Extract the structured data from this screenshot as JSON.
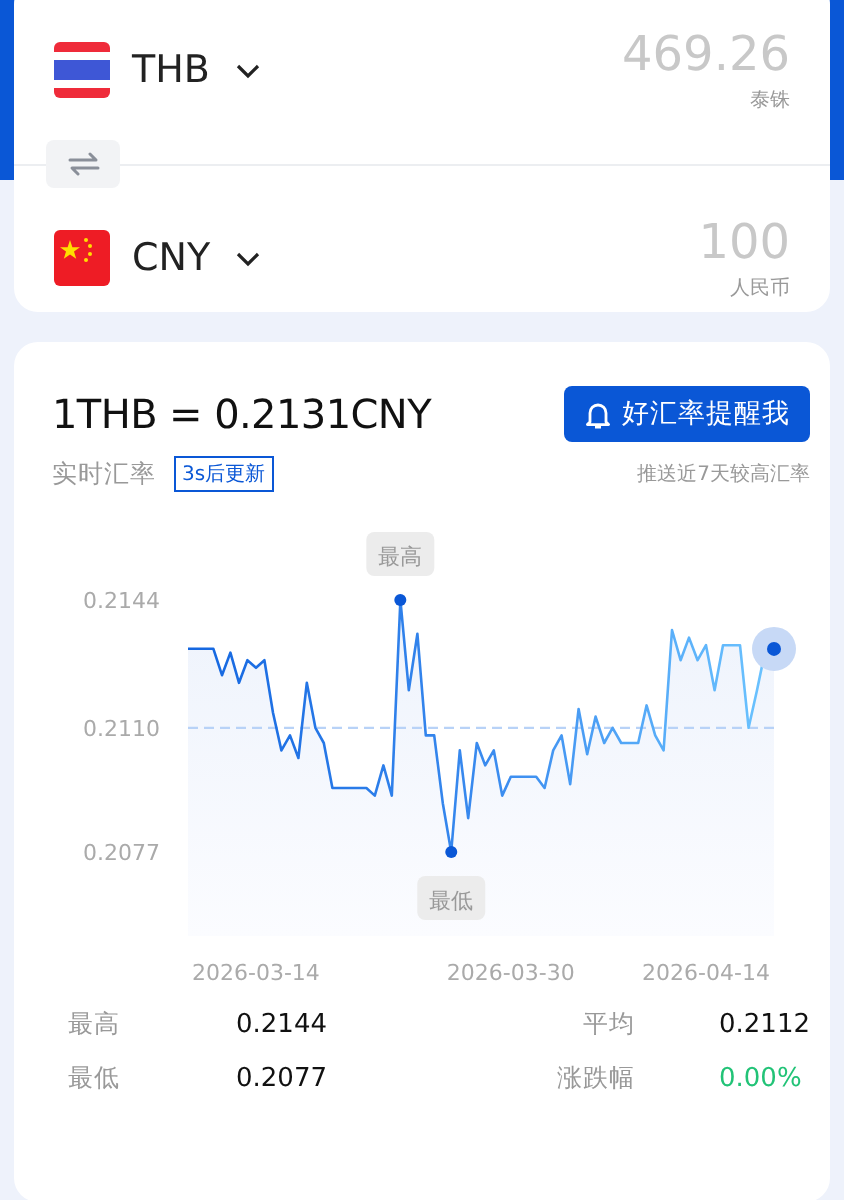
{
  "converter": {
    "currencies": [
      {
        "kind": "th",
        "code": "THB",
        "amount": "469.26",
        "name": "泰铢"
      },
      {
        "kind": "cn",
        "code": "CNY",
        "amount": "100",
        "name": "人民币"
      }
    ]
  },
  "rate": {
    "title": "1THB = 0.2131CNY",
    "label": "实时汇率",
    "refresh": "3s后更新",
    "alert_button": "好汇率提醒我",
    "alert_note": "推送近7天较高汇率"
  },
  "chart_data": {
    "type": "area",
    "ylim": [
      0.2077,
      0.2144
    ],
    "yticks": [
      {
        "value": 0.2144,
        "label": "0.2144"
      },
      {
        "value": 0.211,
        "label": "0.2110"
      },
      {
        "value": 0.2077,
        "label": "0.2077"
      }
    ],
    "categories": [
      null,
      null,
      null,
      null,
      null,
      null,
      null,
      null,
      "2026-03-14",
      null,
      null,
      null,
      null,
      null,
      null,
      null,
      null,
      null,
      null,
      null,
      null,
      null,
      null,
      null,
      null,
      null,
      null,
      null,
      null,
      null,
      null,
      null,
      null,
      null,
      null,
      null,
      null,
      null,
      "2026-03-30",
      null,
      null,
      null,
      null,
      null,
      null,
      null,
      null,
      null,
      null,
      null,
      null,
      null,
      null,
      null,
      null,
      null,
      null,
      null,
      null,
      null,
      null,
      "2026-04-14",
      null,
      null,
      null,
      null,
      null,
      null,
      null,
      null
    ],
    "series": [
      {
        "color": "#1466e0",
        "values": [
          0.2131,
          0.2131,
          0.2131,
          0.2131,
          0.2124,
          0.213,
          0.2122,
          0.2128,
          0.2126,
          0.2128,
          0.2114,
          0.2104,
          0.2108,
          0.2102,
          0.2122,
          0.211,
          0.2106,
          0.2094,
          0.2094,
          0.2094,
          0.2094,
          0.2094,
          0.2092,
          0.21,
          0.2092,
          0.2144,
          0.212,
          0.2135,
          0.2108,
          0.2108,
          0.209,
          0.2077,
          0.2104,
          0.2086,
          0.2106,
          0.21,
          0.2104,
          0.2092,
          0.2097,
          0.2097,
          0.2097,
          0.2097,
          0.2094,
          0.2104,
          0.2108,
          0.2095,
          0.2115,
          0.2103,
          0.2113,
          0.2106,
          0.211,
          0.2106,
          0.2106,
          0.2106,
          0.2116,
          0.2108,
          0.2104,
          0.2136,
          0.2128,
          0.2134,
          0.2128,
          0.2132,
          0.212,
          0.2132,
          0.2132,
          0.2132,
          0.211,
          0.212,
          0.2131,
          0.2131
        ]
      }
    ],
    "ref_lines": [
      {
        "axis": "y",
        "value": 0.211
      }
    ],
    "annotations": [
      {
        "text": "最高",
        "y": 0.2144
      },
      {
        "text": "最低",
        "y": 0.2077
      }
    ]
  },
  "stats": [
    {
      "kind": "plain",
      "label": "最高",
      "value": "0.2144"
    },
    {
      "kind": "plain",
      "label": "平均",
      "value": "0.2112"
    },
    {
      "kind": "plain",
      "label": "最低",
      "value": "0.2077"
    },
    {
      "kind": "change",
      "label": "涨跌幅",
      "value": "0.00%"
    }
  ]
}
